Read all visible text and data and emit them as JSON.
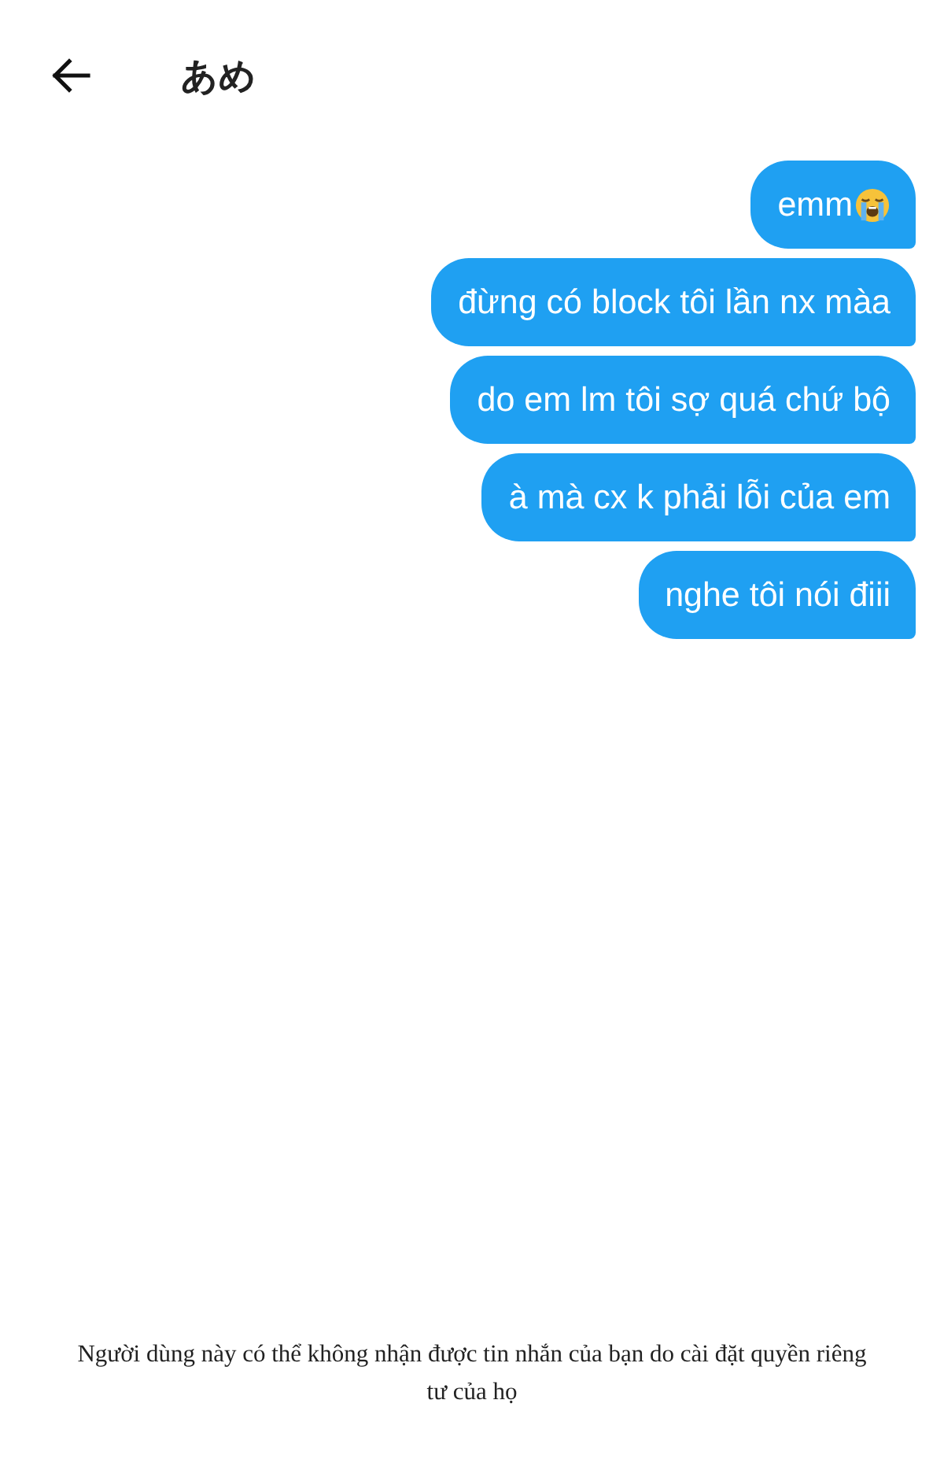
{
  "header": {
    "title": "あめ"
  },
  "messages": [
    {
      "text": "emm",
      "emoji": true
    },
    {
      "text": "đừng có block tôi lần nx màa",
      "emoji": false
    },
    {
      "text": "do em lm tôi sợ quá chứ bộ",
      "emoji": false
    },
    {
      "text": "à mà cx k phải lỗi của em",
      "emoji": false
    },
    {
      "text": "nghe tôi nói điii",
      "emoji": false
    }
  ],
  "notice": "Người dùng này có thể không nhận được tin nhắn của bạn do cài đặt quyền riêng tư của họ"
}
